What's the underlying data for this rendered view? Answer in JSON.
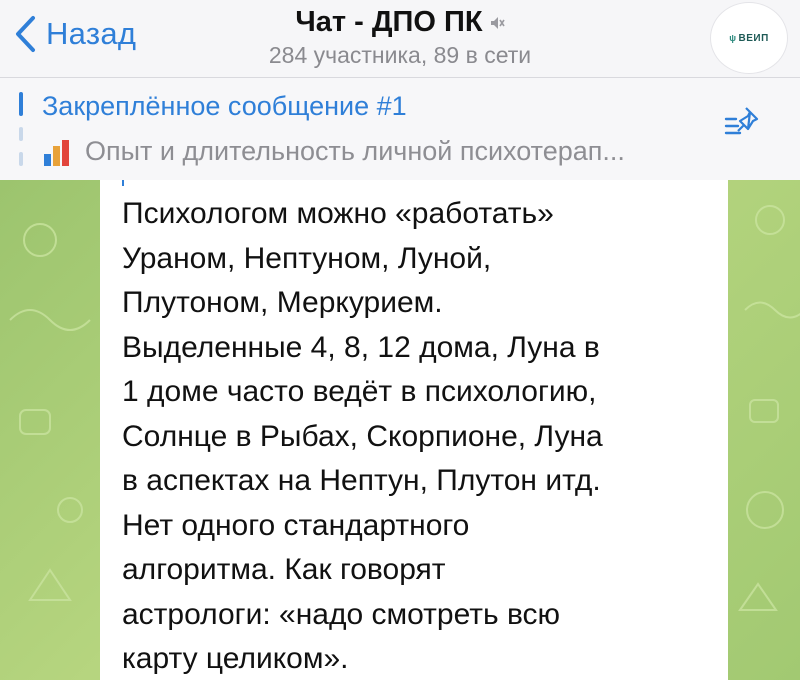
{
  "header": {
    "back_label": "Назад",
    "title": "Чат - ДПО ПК",
    "subtitle": "284 участника, 89 в сети",
    "avatar_text": "ВЕИП"
  },
  "pinned": {
    "title": "Закреплённое сообщение #1",
    "preview": "Опыт и длительность личной психотерап..."
  },
  "message": {
    "text": "Психологом можно «работать»\nУраном, Нептуном, Луной,\nПлутоном, Меркурием.\nВыделенные 4, 8, 12 дома, Луна в\n1 доме часто ведёт в психологию,\nСолнце в Рыбах, Скорпионе, Луна\nв аспектах на Нептун, Плутон итд.\nНет одного стандартного\nалгоритма. Как говорят\nастрологи: «надо смотреть всю\nкарту целиком»."
  },
  "colors": {
    "accent": "#2f7fd8",
    "chat_background": "#a6cc74",
    "poll_bars": [
      "#2f7fd8",
      "#e8a23a",
      "#e2453c"
    ]
  },
  "icons": [
    "chevron-left-icon",
    "mute-icon",
    "poll-icon",
    "pinned-list-icon"
  ]
}
